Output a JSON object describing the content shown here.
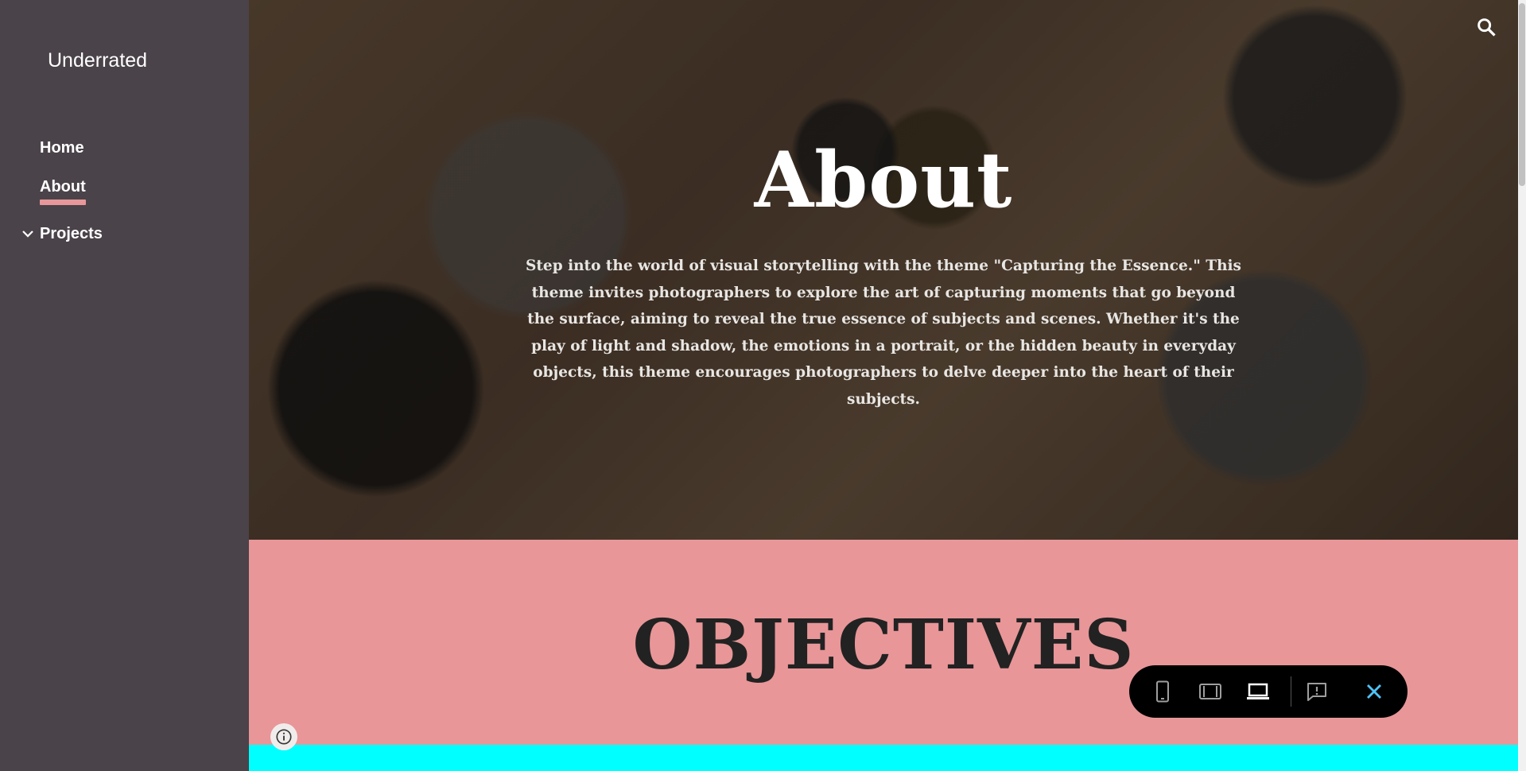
{
  "site": {
    "title": "Underrated"
  },
  "nav": {
    "home": "Home",
    "about": "About",
    "projects": "Projects"
  },
  "hero": {
    "title": "About",
    "text": "Step into the world of visual storytelling with the theme \"Capturing the Essence.\" This theme invites photographers to explore the art of capturing moments that go beyond the surface, aiming to reveal the true essence of subjects and scenes. Whether it's the play of light and shadow, the emotions in a portrait, or the hidden beauty in everyday objects, this theme encourages photographers to delve deeper into the heart of their subjects."
  },
  "objectives": {
    "title": "OBJECTIVES"
  },
  "icons": {
    "search": "search-icon",
    "chevron": "chevron-down-icon",
    "info": "info-icon",
    "phone": "phone-preview-icon",
    "tablet": "tablet-preview-icon",
    "laptop": "laptop-preview-icon",
    "report": "report-abuse-icon",
    "close": "close-icon"
  },
  "colors": {
    "sidebar": "#4a4349",
    "accent": "#e8989a",
    "objectives_bg": "#e89698",
    "band": "#00ffff",
    "close": "#4fc3f7"
  }
}
